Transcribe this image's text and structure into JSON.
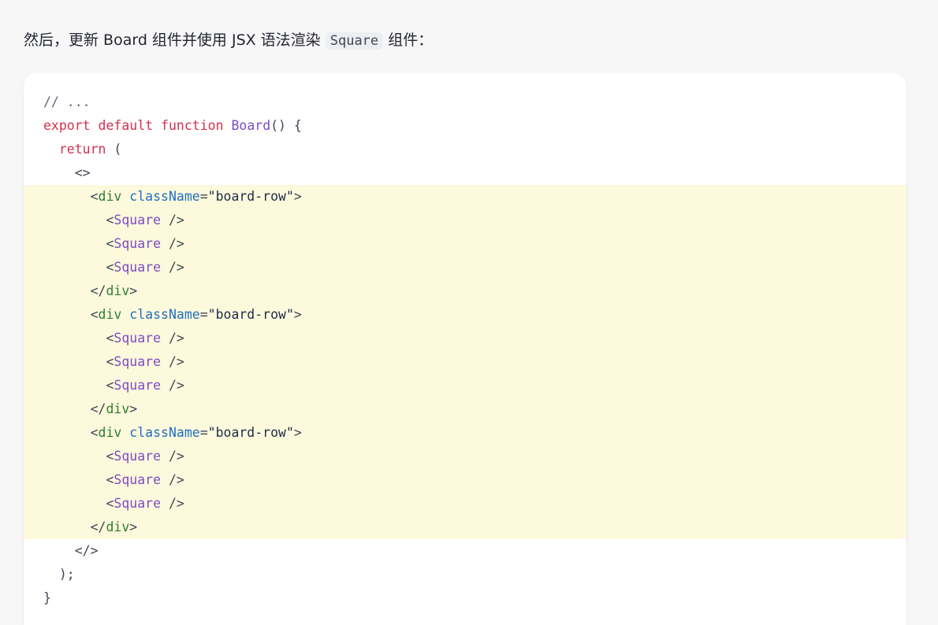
{
  "intro": {
    "before": "然后，更新 Board 组件并使用 JSX 语法渲染 ",
    "code": "Square",
    "after": " 组件："
  },
  "code": {
    "l1": {
      "comment": "// ..."
    },
    "l2": {
      "kw1": "export",
      "kw2": "default",
      "kw3": "function",
      "fn": "Board",
      "rest": "() {"
    },
    "l3": {
      "indent": "  ",
      "kw": "return",
      "rest": " ("
    },
    "l4": {
      "text": "    <>"
    },
    "row_div_open": {
      "indent": "      <",
      "tag": "div",
      "attr": "className",
      "eq": "=",
      "str": "\"board-row\"",
      "close": ">"
    },
    "square": {
      "indent": "        <",
      "comp": "Square",
      "close": " />"
    },
    "row_div_close": {
      "indent": "      </",
      "tag": "div",
      "close": ">"
    },
    "l17": {
      "text": "    </>"
    },
    "l18": {
      "text": "  );"
    },
    "l19": {
      "text": "}"
    }
  },
  "colors": {
    "highlight": "#fdf9dc",
    "keyword": "#d33052",
    "function": "#7b4cc4",
    "tag": "#2e7d32",
    "attribute": "#1f6fc2",
    "string": "#1c2c4a"
  }
}
